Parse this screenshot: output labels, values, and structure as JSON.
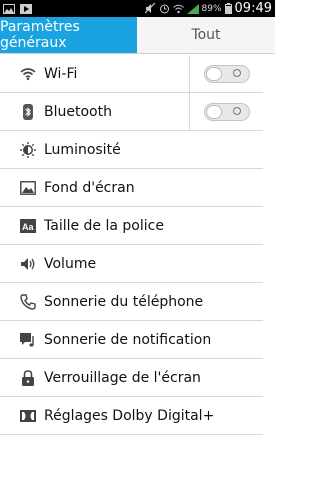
{
  "status": {
    "battery": "89%",
    "time": "09:49"
  },
  "tabs": {
    "general": "Paramètres généraux",
    "all": "Tout"
  },
  "items": [
    {
      "label": "Wi-Fi",
      "icon": "wifi-icon",
      "toggle": false
    },
    {
      "label": "Bluetooth",
      "icon": "bluetooth-icon",
      "toggle": false
    },
    {
      "label": "Luminosité",
      "icon": "brightness-icon"
    },
    {
      "label": "Fond d'écran",
      "icon": "wallpaper-icon"
    },
    {
      "label": "Taille de la police",
      "icon": "font-size-icon"
    },
    {
      "label": "Volume",
      "icon": "volume-icon"
    },
    {
      "label": "Sonnerie du téléphone",
      "icon": "ringtone-icon"
    },
    {
      "label": "Sonnerie de notification",
      "icon": "notification-sound-icon"
    },
    {
      "label": "Verrouillage de l'écran",
      "icon": "lock-icon"
    },
    {
      "label": "Réglages Dolby Digital+",
      "icon": "dolby-icon"
    }
  ]
}
